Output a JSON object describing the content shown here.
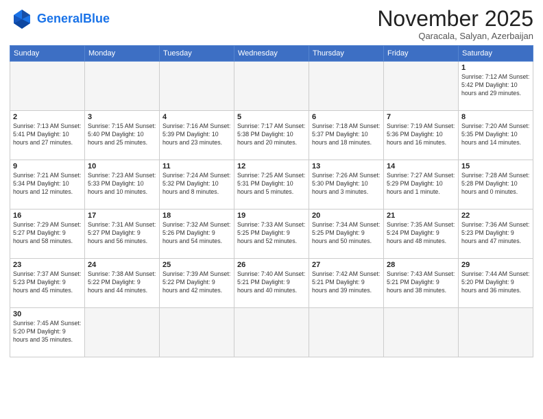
{
  "header": {
    "logo_general": "General",
    "logo_blue": "Blue",
    "month_title": "November 2025",
    "location": "Qaracala, Salyan, Azerbaijan"
  },
  "weekdays": [
    "Sunday",
    "Monday",
    "Tuesday",
    "Wednesday",
    "Thursday",
    "Friday",
    "Saturday"
  ],
  "days": [
    {
      "num": "",
      "info": ""
    },
    {
      "num": "",
      "info": ""
    },
    {
      "num": "",
      "info": ""
    },
    {
      "num": "",
      "info": ""
    },
    {
      "num": "",
      "info": ""
    },
    {
      "num": "",
      "info": ""
    },
    {
      "num": "1",
      "info": "Sunrise: 7:12 AM\nSunset: 5:42 PM\nDaylight: 10 hours\nand 29 minutes."
    },
    {
      "num": "2",
      "info": "Sunrise: 7:13 AM\nSunset: 5:41 PM\nDaylight: 10 hours\nand 27 minutes."
    },
    {
      "num": "3",
      "info": "Sunrise: 7:15 AM\nSunset: 5:40 PM\nDaylight: 10 hours\nand 25 minutes."
    },
    {
      "num": "4",
      "info": "Sunrise: 7:16 AM\nSunset: 5:39 PM\nDaylight: 10 hours\nand 23 minutes."
    },
    {
      "num": "5",
      "info": "Sunrise: 7:17 AM\nSunset: 5:38 PM\nDaylight: 10 hours\nand 20 minutes."
    },
    {
      "num": "6",
      "info": "Sunrise: 7:18 AM\nSunset: 5:37 PM\nDaylight: 10 hours\nand 18 minutes."
    },
    {
      "num": "7",
      "info": "Sunrise: 7:19 AM\nSunset: 5:36 PM\nDaylight: 10 hours\nand 16 minutes."
    },
    {
      "num": "8",
      "info": "Sunrise: 7:20 AM\nSunset: 5:35 PM\nDaylight: 10 hours\nand 14 minutes."
    },
    {
      "num": "9",
      "info": "Sunrise: 7:21 AM\nSunset: 5:34 PM\nDaylight: 10 hours\nand 12 minutes."
    },
    {
      "num": "10",
      "info": "Sunrise: 7:23 AM\nSunset: 5:33 PM\nDaylight: 10 hours\nand 10 minutes."
    },
    {
      "num": "11",
      "info": "Sunrise: 7:24 AM\nSunset: 5:32 PM\nDaylight: 10 hours\nand 8 minutes."
    },
    {
      "num": "12",
      "info": "Sunrise: 7:25 AM\nSunset: 5:31 PM\nDaylight: 10 hours\nand 5 minutes."
    },
    {
      "num": "13",
      "info": "Sunrise: 7:26 AM\nSunset: 5:30 PM\nDaylight: 10 hours\nand 3 minutes."
    },
    {
      "num": "14",
      "info": "Sunrise: 7:27 AM\nSunset: 5:29 PM\nDaylight: 10 hours\nand 1 minute."
    },
    {
      "num": "15",
      "info": "Sunrise: 7:28 AM\nSunset: 5:28 PM\nDaylight: 10 hours\nand 0 minutes."
    },
    {
      "num": "16",
      "info": "Sunrise: 7:29 AM\nSunset: 5:27 PM\nDaylight: 9 hours\nand 58 minutes."
    },
    {
      "num": "17",
      "info": "Sunrise: 7:31 AM\nSunset: 5:27 PM\nDaylight: 9 hours\nand 56 minutes."
    },
    {
      "num": "18",
      "info": "Sunrise: 7:32 AM\nSunset: 5:26 PM\nDaylight: 9 hours\nand 54 minutes."
    },
    {
      "num": "19",
      "info": "Sunrise: 7:33 AM\nSunset: 5:25 PM\nDaylight: 9 hours\nand 52 minutes."
    },
    {
      "num": "20",
      "info": "Sunrise: 7:34 AM\nSunset: 5:25 PM\nDaylight: 9 hours\nand 50 minutes."
    },
    {
      "num": "21",
      "info": "Sunrise: 7:35 AM\nSunset: 5:24 PM\nDaylight: 9 hours\nand 48 minutes."
    },
    {
      "num": "22",
      "info": "Sunrise: 7:36 AM\nSunset: 5:23 PM\nDaylight: 9 hours\nand 47 minutes."
    },
    {
      "num": "23",
      "info": "Sunrise: 7:37 AM\nSunset: 5:23 PM\nDaylight: 9 hours\nand 45 minutes."
    },
    {
      "num": "24",
      "info": "Sunrise: 7:38 AM\nSunset: 5:22 PM\nDaylight: 9 hours\nand 44 minutes."
    },
    {
      "num": "25",
      "info": "Sunrise: 7:39 AM\nSunset: 5:22 PM\nDaylight: 9 hours\nand 42 minutes."
    },
    {
      "num": "26",
      "info": "Sunrise: 7:40 AM\nSunset: 5:21 PM\nDaylight: 9 hours\nand 40 minutes."
    },
    {
      "num": "27",
      "info": "Sunrise: 7:42 AM\nSunset: 5:21 PM\nDaylight: 9 hours\nand 39 minutes."
    },
    {
      "num": "28",
      "info": "Sunrise: 7:43 AM\nSunset: 5:21 PM\nDaylight: 9 hours\nand 38 minutes."
    },
    {
      "num": "29",
      "info": "Sunrise: 7:44 AM\nSunset: 5:20 PM\nDaylight: 9 hours\nand 36 minutes."
    },
    {
      "num": "30",
      "info": "Sunrise: 7:45 AM\nSunset: 5:20 PM\nDaylight: 9 hours\nand 35 minutes."
    },
    {
      "num": "",
      "info": ""
    },
    {
      "num": "",
      "info": ""
    },
    {
      "num": "",
      "info": ""
    },
    {
      "num": "",
      "info": ""
    },
    {
      "num": "",
      "info": ""
    },
    {
      "num": "",
      "info": ""
    }
  ]
}
